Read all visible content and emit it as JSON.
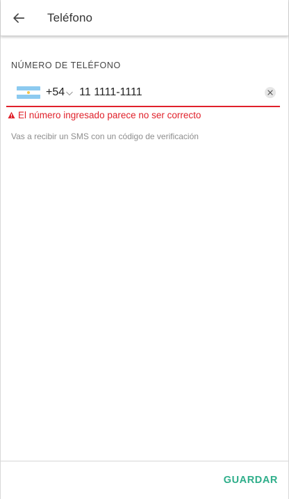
{
  "header": {
    "title": "Teléfono",
    "back_icon": "arrow-left-icon"
  },
  "phone_field": {
    "label": "NÚMERO DE TELÉFONO",
    "country_flag": "argentina-flag-icon",
    "country_code": "+54",
    "value": "11 1111-1111",
    "clear_icon": "close-icon"
  },
  "error": {
    "icon": "warning-icon",
    "message": "El número ingresado parece no ser correcto",
    "color": "#e0202a"
  },
  "helper_text": "Vas a recibir un SMS con un código de verificación",
  "footer": {
    "save_label": "GUARDAR",
    "accent": "#2eae8a"
  }
}
